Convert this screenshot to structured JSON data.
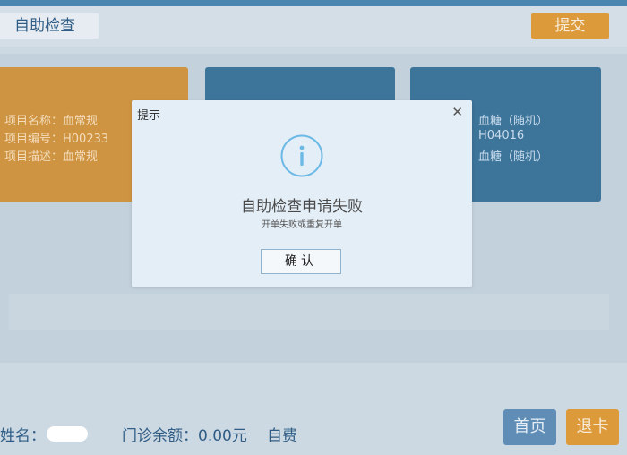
{
  "header": {
    "title": "自助检查",
    "submit_label": "提交"
  },
  "cards": [
    {
      "lines": [
        "项目名称：血常规",
        "项目编号：H00233",
        "项目描述：血常规"
      ]
    },
    {
      "lines": []
    },
    {
      "lines": [
        "血糖（随机）",
        "H04016",
        "血糖（随机）"
      ]
    }
  ],
  "footer": {
    "name_label": "姓名：",
    "balance_text": "门诊余额：0.00元",
    "payment_type": "自费",
    "home_label": "首页",
    "logout_label": "退卡"
  },
  "modal": {
    "title": "提示",
    "close_icon": "close-icon",
    "icon": "info-icon",
    "message": "自助检查申请失败",
    "detail": "开单失败或重复开单",
    "confirm_label": "确认"
  },
  "colors": {
    "accent_orange": "#dd9a3a",
    "card_blue": "#3d7499",
    "info_blue": "#6cb9e6",
    "text_blue": "#2f5d86"
  }
}
